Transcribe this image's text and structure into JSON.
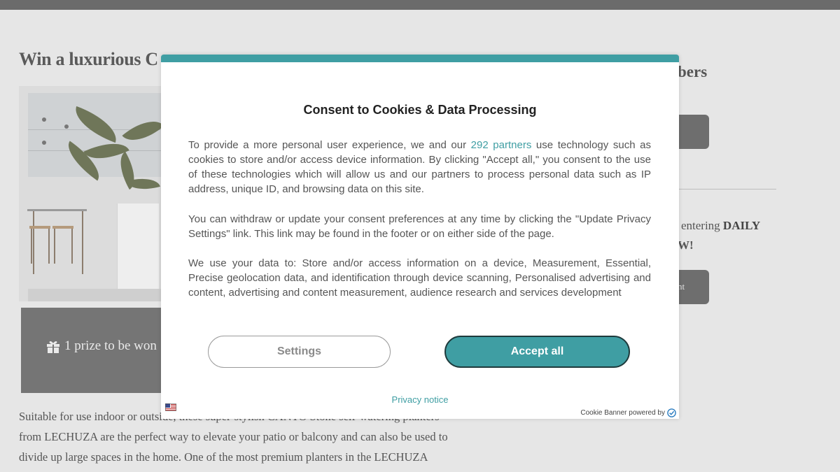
{
  "page": {
    "title": "Win a luxurious C",
    "prize_text": "1 prize to be won",
    "body_lines": [
      "Suitable for use indoor or outside, these super-stylish CANTO Stone self-watering planters",
      "from LECHUZA are the perfect way to elevate your patio or balcony and can also be used to",
      "divide up large spaces in the home. One of the most premium planters in the LECHUZA"
    ]
  },
  "sidebar": {
    "title": "bers",
    "entry_text_prefix": "t entering ",
    "entry_text_bold": "DAILY",
    "entry_text2": "W!",
    "button2_label": "nt"
  },
  "modal": {
    "title": "Consent to Cookies & Data Processing",
    "para1_before": "To provide a more personal user experience, we and our ",
    "partners_link": "292 partners",
    "para1_after": " use technology such as cookies to store and/or access device information. By clicking \"Accept all,\" you consent to the use of these technologies which will allow us and our partners to process personal data such as IP address, unique ID, and browsing data on this site.",
    "para2": "You can withdraw or update your consent preferences at any time by clicking the \"Update Privacy Settings\" link. This link may be found in the footer or on either side of the page.",
    "para3": "We use your data to: Store and/or access information on a device, Measurement, Essential, Precise geolocation data, and identification through device scanning, Personalised advertising and content, advertising and content measurement, audience research and services development",
    "settings_label": "Settings",
    "accept_label": "Accept all",
    "privacy_label": "Privacy notice",
    "powered_by": "Cookie Banner powered by"
  },
  "colors": {
    "accent": "#3f9ea3",
    "overlay_bg": "#e6e6e6",
    "dark_button": "#6e6e6e"
  }
}
